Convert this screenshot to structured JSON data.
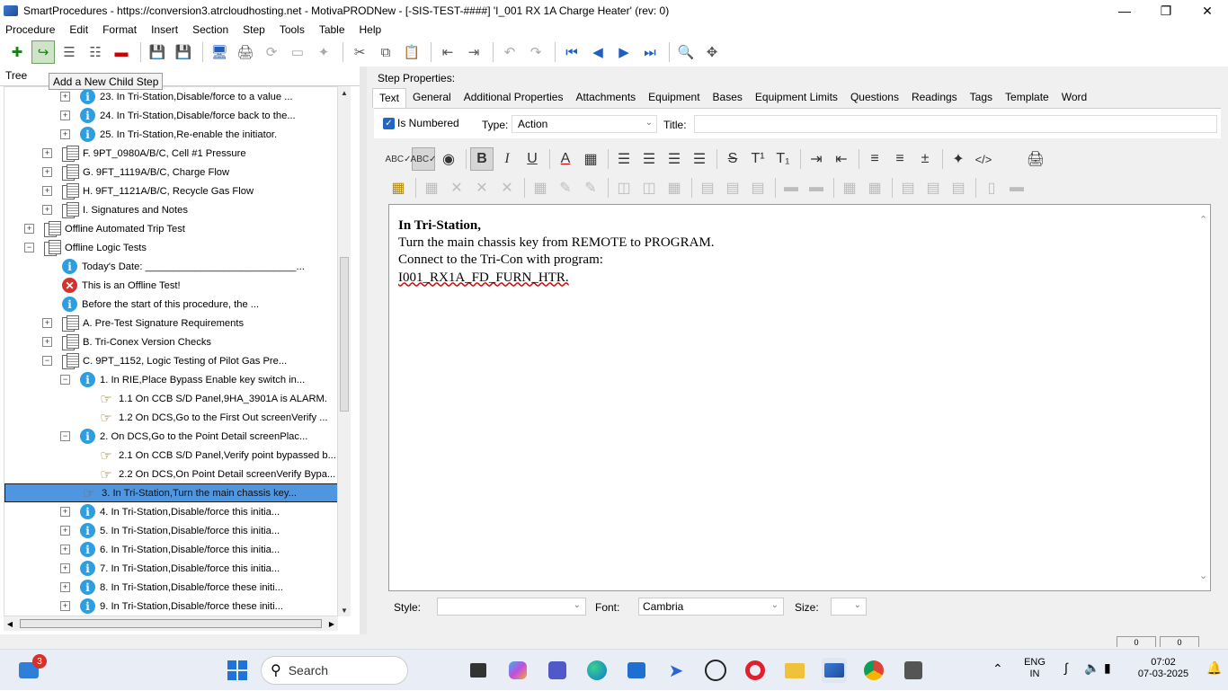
{
  "window": {
    "title": "SmartProcedures - https://conversion3.atrcloudhosting.net - MotivaPRODNew - [-SIS-TEST-####] 'I_001 RX 1A Charge Heater' (rev: 0)"
  },
  "menu": [
    "Procedure",
    "Edit",
    "Format",
    "Insert",
    "Section",
    "Step",
    "Tools",
    "Table",
    "Help"
  ],
  "tooltip": "Add a New Child Step",
  "left_tab": "Tree",
  "tree": [
    {
      "indent": 3,
      "exp": "+",
      "icon": "info",
      "label": "23. In Tri-Station,Disable/force to a value ..."
    },
    {
      "indent": 3,
      "exp": "+",
      "icon": "info",
      "label": "24. In Tri-Station,Disable/force back to the..."
    },
    {
      "indent": 3,
      "exp": "+",
      "icon": "info",
      "label": "25. In Tri-Station,Re-enable the initiator."
    },
    {
      "indent": 2,
      "exp": "+",
      "icon": "doc",
      "label": "F. 9PT_0980A/B/C, Cell #1 Pressure"
    },
    {
      "indent": 2,
      "exp": "+",
      "icon": "doc",
      "label": "G. 9FT_1119A/B/C, Charge Flow"
    },
    {
      "indent": 2,
      "exp": "+",
      "icon": "doc",
      "label": "H. 9FT_1121A/B/C, Recycle Gas Flow"
    },
    {
      "indent": 2,
      "exp": "+",
      "icon": "doc",
      "label": "I. Signatures and Notes"
    },
    {
      "indent": 1,
      "exp": "+",
      "icon": "doc",
      "label": "Offline Automated Trip Test"
    },
    {
      "indent": 1,
      "exp": "-",
      "icon": "doc",
      "label": "Offline Logic Tests"
    },
    {
      "indent": 2,
      "exp": "",
      "icon": "info",
      "label": "Today's Date: ___________________________..."
    },
    {
      "indent": 2,
      "exp": "",
      "icon": "err",
      "label": "This is an Offline Test!"
    },
    {
      "indent": 2,
      "exp": "",
      "icon": "info",
      "label": "Before the start of this procedure, the ..."
    },
    {
      "indent": 2,
      "exp": "+",
      "icon": "doc",
      "label": "A. Pre-Test Signature Requirements"
    },
    {
      "indent": 2,
      "exp": "+",
      "icon": "doc",
      "label": "B. Tri-Conex Version Checks"
    },
    {
      "indent": 2,
      "exp": "-",
      "icon": "doc",
      "label": "C. 9PT_1152, Logic Testing of Pilot Gas Pre..."
    },
    {
      "indent": 3,
      "exp": "-",
      "icon": "info",
      "label": "1. In RIE,Place Bypass Enable key switch in..."
    },
    {
      "indent": 4,
      "exp": "",
      "icon": "hand",
      "label": "1.1 On CCB S/D Panel,9HA_3901A is ALARM."
    },
    {
      "indent": 4,
      "exp": "",
      "icon": "hand",
      "label": "1.2 On DCS,Go to the First Out screenVerify ..."
    },
    {
      "indent": 3,
      "exp": "-",
      "icon": "info",
      "label": "2. On DCS,Go to the Point Detail screenPlac..."
    },
    {
      "indent": 4,
      "exp": "",
      "icon": "hand",
      "label": "2.1 On CCB S/D Panel,Verify point bypassed b..."
    },
    {
      "indent": 4,
      "exp": "",
      "icon": "hand",
      "label": "2.2 On DCS,On Point Detail screenVerify Bypa..."
    },
    {
      "indent": 3,
      "exp": "",
      "icon": "hand",
      "label": "3. In Tri-Station,Turn the main chassis key...",
      "selected": true
    },
    {
      "indent": 3,
      "exp": "+",
      "icon": "info",
      "label": "4. In Tri-Station,Disable/force this initia..."
    },
    {
      "indent": 3,
      "exp": "+",
      "icon": "info",
      "label": "5. In Tri-Station,Disable/force this initia..."
    },
    {
      "indent": 3,
      "exp": "+",
      "icon": "info",
      "label": "6. In Tri-Station,Disable/force this initia..."
    },
    {
      "indent": 3,
      "exp": "+",
      "icon": "info",
      "label": "7. In Tri-Station,Disable/force this initia..."
    },
    {
      "indent": 3,
      "exp": "+",
      "icon": "info",
      "label": "8. In Tri-Station,Disable/force these initi..."
    },
    {
      "indent": 3,
      "exp": "+",
      "icon": "info",
      "label": "9. In Tri-Station,Disable/force these initi..."
    }
  ],
  "step_properties_label": "Step Properties:",
  "prop_tabs": [
    "Text",
    "General",
    "Additional Properties",
    "Attachments",
    "Equipment",
    "Bases",
    "Equipment Limits",
    "Questions",
    "Readings",
    "Tags",
    "Template",
    "Word"
  ],
  "prop_tabs_active": "Text",
  "is_numbered_label": "Is Numbered",
  "type_label": "Type:",
  "type_value": "Action",
  "title_label": "Title:",
  "title_value": "",
  "editor": {
    "line1": "In Tri-Station,",
    "line2": "Turn the main chassis key from REMOTE to PROGRAM.",
    "line3": "Connect to the Tri-Con with program:",
    "line4": "I001_RX1A_FD_FURN_HTR."
  },
  "bottom": {
    "style_label": "Style:",
    "style_value": "",
    "font_label": "Font:",
    "font_value": "Cambria",
    "size_label": "Size:",
    "size_value": ""
  },
  "statusbar": [
    "0",
    "0"
  ],
  "taskbar": {
    "search_placeholder": "Search",
    "notif_badge": "3",
    "lang_top": "ENG",
    "lang_bottom": "IN",
    "time": "07:02",
    "date": "07-03-2025"
  }
}
